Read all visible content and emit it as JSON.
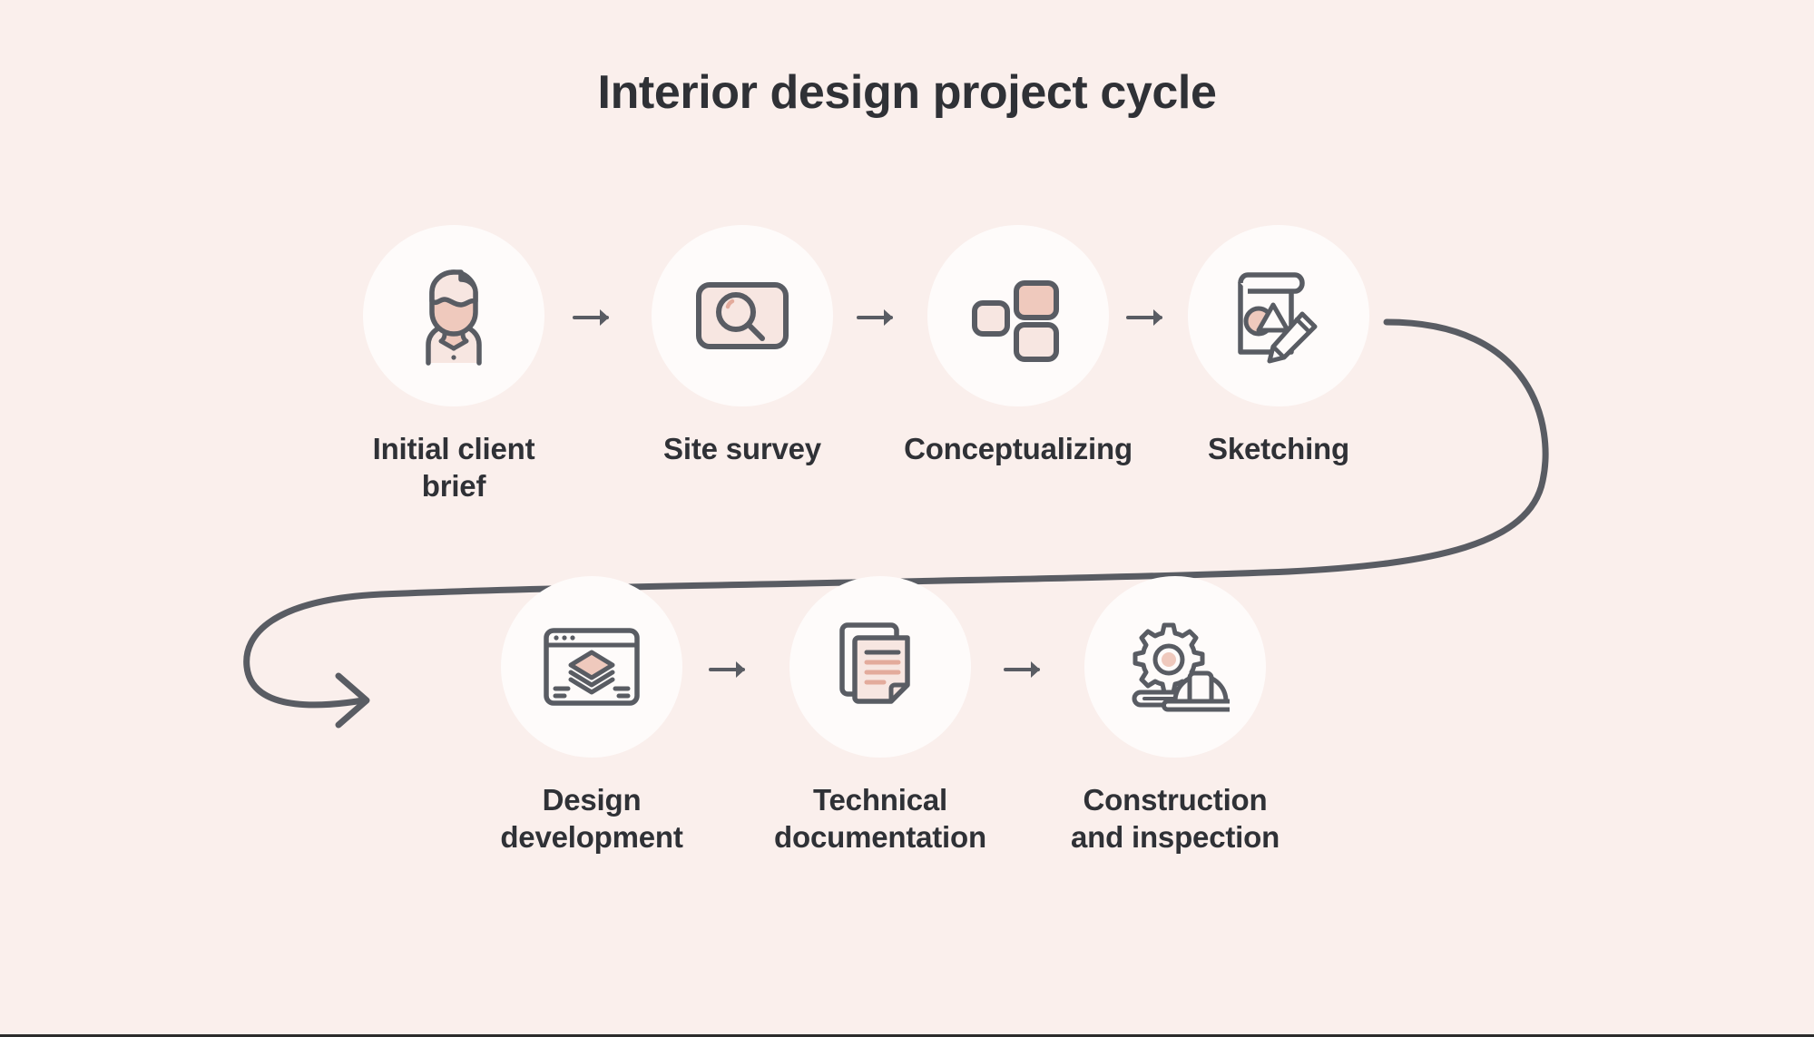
{
  "page": {
    "title": "Interior design project cycle",
    "background_color": "#faefec",
    "circle_color": "#fefbfa",
    "stroke_color": "#595c63",
    "text_color": "#2f3136",
    "accent_pink": "#e3ab9c",
    "light_pink": "#f7e6e1",
    "mid_pink": "#efc9bd"
  },
  "flow": {
    "type": "process-cycle",
    "row_one": [
      {
        "index": 1,
        "label": "Initial client\nbrief",
        "icon": "person-avatar-icon"
      },
      {
        "index": 2,
        "label": "Site survey",
        "icon": "magnifier-screen-icon"
      },
      {
        "index": 3,
        "label": "Conceptualizing",
        "icon": "layout-blocks-icon"
      },
      {
        "index": 4,
        "label": "Sketching",
        "icon": "sketchpad-pencil-icon"
      }
    ],
    "row_two": [
      {
        "index": 5,
        "label": "Design\ndevelopment",
        "icon": "browser-layers-icon"
      },
      {
        "index": 6,
        "label": "Technical\ndocumentation",
        "icon": "documents-icon"
      },
      {
        "index": 7,
        "label": "Construction\nand inspection",
        "icon": "gear-hardhat-icon"
      }
    ],
    "connectors": {
      "step_arrow": "arrow-right-icon",
      "wrap_arrow": "curved-arrow-right-icon"
    }
  }
}
